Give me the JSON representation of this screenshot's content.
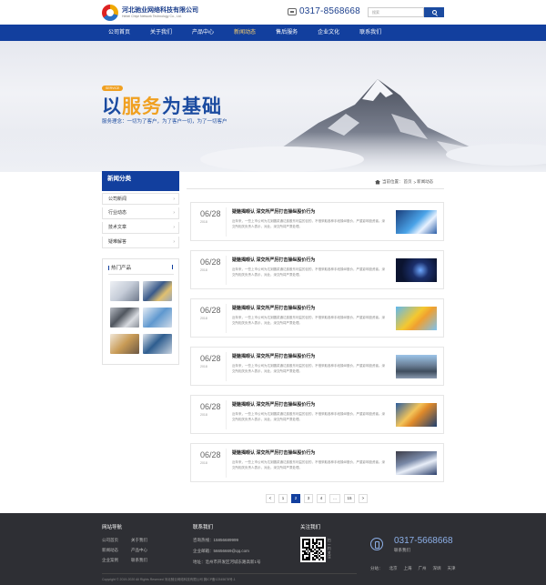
{
  "header": {
    "company_cn": "河北驰业网络科技有限公司",
    "company_en": "Hebei Chiye Network Technology Co., Ltd.",
    "phone": "0317-8568668",
    "search_placeholder": "搜索"
  },
  "nav": {
    "items": [
      "公司首页",
      "关于我们",
      "产品中心",
      "新闻动态",
      "售后服务",
      "企业文化",
      "联系我们"
    ],
    "active_index": 3
  },
  "banner": {
    "badge": "SERVICE",
    "slogan_pre": "以",
    "slogan_hl": "服务",
    "slogan_post": "为基础",
    "sub": "服务理念：一切为了客户，为了客户一切，为了一切客户"
  },
  "sidebar": {
    "title": "新闻分类",
    "items": [
      "公司新闻",
      "行业动态",
      "技术文章",
      "疑难解答"
    ],
    "hot_title": "热门产品"
  },
  "breadcrumb": {
    "label": "当前位置：",
    "home": "首页",
    "sep": ">",
    "current": "新闻动态"
  },
  "news": [
    {
      "day": "06/28",
      "year": "2018",
      "title": "疑魅揭眼认 深交所严厉打击操纵股价行为",
      "summary": "近年来，一些上市公司为达到圆浆通达费股东利益的目的，不惜采取各种手段操纵股价，严重影响投资者。深交所相关负责人表示，对此，深交所将严肃处理。"
    },
    {
      "day": "06/28",
      "year": "2018",
      "title": "疑魅揭眼认 深交所严厉打击操纵股价行为",
      "summary": "近年来，一些上市公司为达到圆浆通达费股东利益的目的，不惜采取各种手段操纵股价，严重影响投资者。深交所相关负责人表示，对此，深交所将严肃处理。"
    },
    {
      "day": "06/28",
      "year": "2018",
      "title": "疑魅揭眼认 深交所严厉打击操纵股价行为",
      "summary": "近年来，一些上市公司为达到圆浆通达费股东利益的目的，不惜采取各种手段操纵股价，严重影响投资者。深交所相关负责人表示，对此，深交所将严肃处理。"
    },
    {
      "day": "06/28",
      "year": "2018",
      "title": "疑魅揭眼认 深交所严厉打击操纵股价行为",
      "summary": "近年来，一些上市公司为达到圆浆通达费股东利益的目的，不惜采取各种手段操纵股价，严重影响投资者。深交所相关负责人表示，对此，深交所将严肃处理。"
    },
    {
      "day": "06/28",
      "year": "2018",
      "title": "疑魅揭眼认 深交所严厉打击操纵股价行为",
      "summary": "近年来，一些上市公司为达到圆浆通达费股东利益的目的，不惜采取各种手段操纵股价，严重影响投资者。深交所相关负责人表示，对此，深交所将严肃处理。"
    },
    {
      "day": "06/28",
      "year": "2018",
      "title": "疑魅揭眼认 深交所严厉打击操纵股价行为",
      "summary": "近年来，一些上市公司为达到圆浆通达费股东利益的目的，不惜采取各种手段操纵股价，严重影响投资者。深交所相关负责人表示，对此，深交所将严肃处理。"
    }
  ],
  "pagination": {
    "prev": "<",
    "pages": [
      "1",
      "2",
      "3",
      "4",
      "...",
      "15"
    ],
    "active": "2",
    "next": ">"
  },
  "footer": {
    "nav_title": "网站导航",
    "nav_links": [
      "公司首页",
      "关于我们",
      "新闻动态",
      "产品中心",
      "企业案例",
      "联系我们"
    ],
    "contact_title": "联系我们",
    "contact_lines": [
      "咨询热线：15856689999",
      "企业邮箱：56656669@qq.com",
      "地址：沧州市开发区河城东路高新1号"
    ],
    "follow_title": "关注我们",
    "qr_side": "扫一扫关注",
    "phone": "0317-5668668",
    "phone_label": "联系我们",
    "cities_label": "分站：",
    "cities": [
      "北京",
      "上海",
      "广州",
      "深圳",
      "天津"
    ],
    "copyright": "Copyright © 2019-2020 All Rights Reserved 河北驰业网络科技有限公司  冀ICP备12345678号-1"
  },
  "colors": {
    "brand_blue": "#123f9e",
    "accent_orange": "#f0a020",
    "footer_bg": "#2e2f34"
  }
}
